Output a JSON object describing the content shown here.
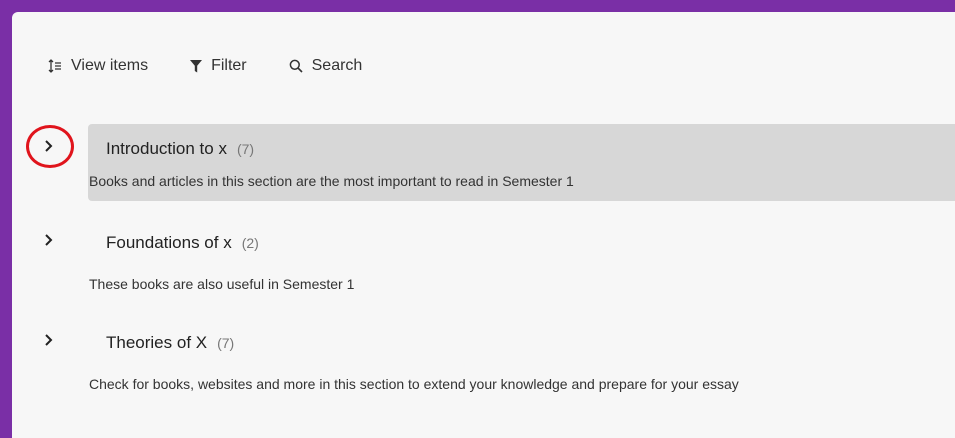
{
  "toolbar": {
    "view_items": {
      "label": "View items",
      "icon": "sort-list-icon"
    },
    "filter": {
      "label": "Filter",
      "icon": "filter-funnel-icon"
    },
    "search": {
      "label": "Search",
      "icon": "search-icon"
    }
  },
  "sections": [
    {
      "title": "Introduction to x",
      "count": "(7)",
      "description": "Books and articles in this section are the most important to read in Semester 1",
      "highlighted": true
    },
    {
      "title": "Foundations of x",
      "count": "(2)",
      "description": "These books are also useful in Semester 1",
      "highlighted": false
    },
    {
      "title": "Theories of X",
      "count": "(7)",
      "description": "Check for books, websites and more in this section to extend your knowledge and prepare for your essay",
      "highlighted": false
    }
  ],
  "colors": {
    "frame": "#7a2fa6",
    "highlight": "#d7d7d7",
    "annotation_circle": "#e0141c"
  }
}
